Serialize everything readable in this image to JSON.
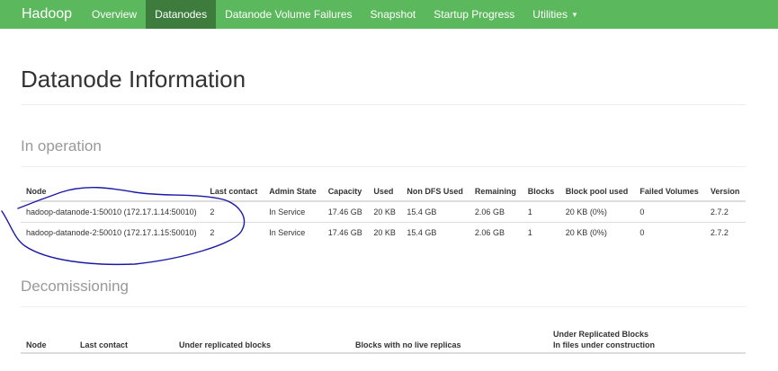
{
  "navbar": {
    "brand": "Hadoop",
    "items": [
      {
        "label": "Overview"
      },
      {
        "label": "Datanodes"
      },
      {
        "label": "Datanode Volume Failures"
      },
      {
        "label": "Snapshot"
      },
      {
        "label": "Startup Progress"
      },
      {
        "label": "Utilities"
      }
    ],
    "active": "Datanodes",
    "dropdown_icon": "caret-down-icon"
  },
  "page": {
    "title": "Datanode Information"
  },
  "in_operation": {
    "title": "In operation",
    "columns": [
      "Node",
      "Last contact",
      "Admin State",
      "Capacity",
      "Used",
      "Non DFS Used",
      "Remaining",
      "Blocks",
      "Block pool used",
      "Failed Volumes",
      "Version"
    ],
    "rows": [
      [
        "hadoop-datanode-1:50010 (172.17.1.14:50010)",
        "2",
        "In Service",
        "17.46 GB",
        "20 KB",
        "15.4 GB",
        "2.06 GB",
        "1",
        "20 KB (0%)",
        "0",
        "2.7.2"
      ],
      [
        "hadoop-datanode-2:50010 (172.17.1.15:50010)",
        "2",
        "In Service",
        "17.46 GB",
        "20 KB",
        "15.4 GB",
        "2.06 GB",
        "1",
        "20 KB (0%)",
        "0",
        "2.7.2"
      ]
    ]
  },
  "decomissioning": {
    "title": "Decomissioning",
    "columns": [
      "Node",
      "Last contact",
      "Under replicated blocks",
      "Blocks with no live replicas",
      "Under Replicated Blocks",
      "In files under construction"
    ]
  },
  "colors": {
    "navbar": "#5cb85c",
    "navbar_active": "#3e7c3e",
    "annotation": "#1a1aa6"
  }
}
